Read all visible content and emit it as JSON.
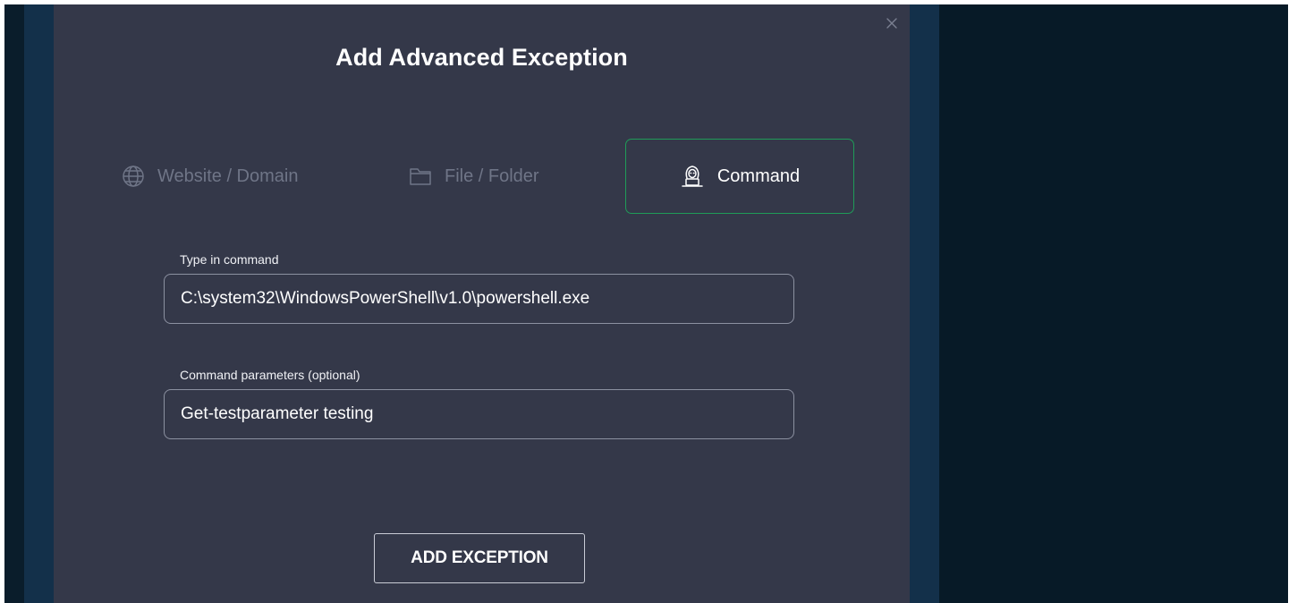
{
  "dialog": {
    "title": "Add Advanced Exception",
    "close_icon": "close-icon"
  },
  "tabs": [
    {
      "label": "Website / Domain",
      "icon": "globe-icon",
      "selected": false
    },
    {
      "label": "File / Folder",
      "icon": "folder-icon",
      "selected": false
    },
    {
      "label": "Command",
      "icon": "hacker-icon",
      "selected": true
    }
  ],
  "form": {
    "command_label": "Type in command",
    "command_value": "C:\\system32\\WindowsPowerShell\\v1.0\\powershell.exe",
    "params_label": "Command parameters (optional)",
    "params_value": "Get-testparameter testing"
  },
  "actions": {
    "add_label": "ADD EXCEPTION"
  },
  "colors": {
    "selected_border": "#1f9c58",
    "dialog_bg": "#343849",
    "backdrop": "#071a27"
  }
}
